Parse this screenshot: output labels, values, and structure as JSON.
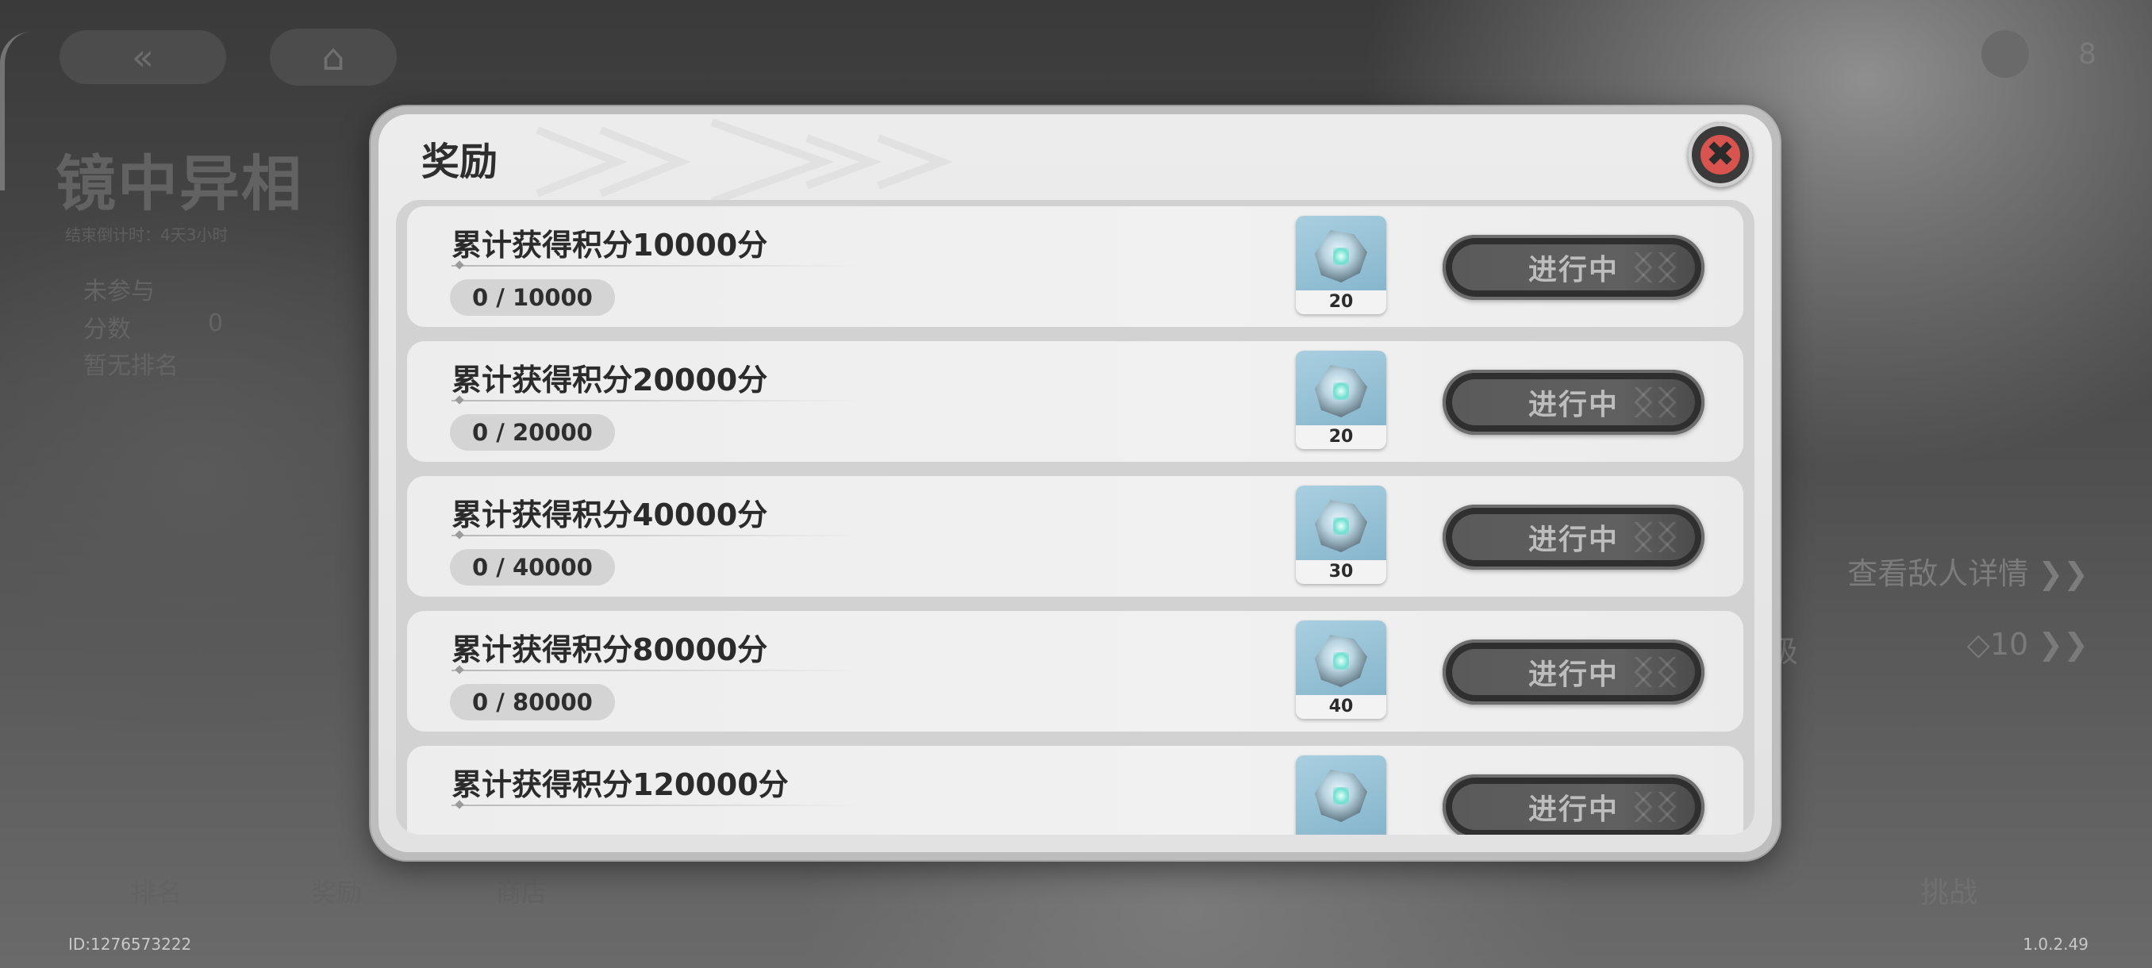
{
  "background": {
    "title": "镜中异相",
    "countdown": "结束倒计时：4天3小时",
    "stats": [
      {
        "label": "未参与",
        "value": ""
      },
      {
        "label": "分数",
        "value": "0"
      },
      {
        "label": "暂无排名",
        "value": ""
      }
    ],
    "currency_value": "8",
    "enemy_details_link": "查看敌人详情 ❯❯",
    "level_label": "级",
    "level_value": "◇10 ❯❯",
    "tabs": [
      "排名",
      "奖励",
      "商店"
    ],
    "challenge_label": "挑战",
    "player_id": "ID:1276573222",
    "version": "1.0.2.49"
  },
  "modal": {
    "title": "奖励",
    "close_icon": "close-icon",
    "rows": [
      {
        "title": "累计获得积分10000分",
        "progress": "0 / 10000",
        "item_count": "20",
        "status": "进行中"
      },
      {
        "title": "累计获得积分20000分",
        "progress": "0 / 20000",
        "item_count": "20",
        "status": "进行中"
      },
      {
        "title": "累计获得积分40000分",
        "progress": "0 / 40000",
        "item_count": "30",
        "status": "进行中"
      },
      {
        "title": "累计获得积分80000分",
        "progress": "0 / 80000",
        "item_count": "40",
        "status": "进行中"
      },
      {
        "title": "累计获得积分120000分",
        "progress": "",
        "item_count": "",
        "status": "进行中"
      }
    ]
  },
  "colors": {
    "close_accent": "#d9534f",
    "item_bg": "#a9cfe0",
    "status_button": "#2f2f2f"
  }
}
